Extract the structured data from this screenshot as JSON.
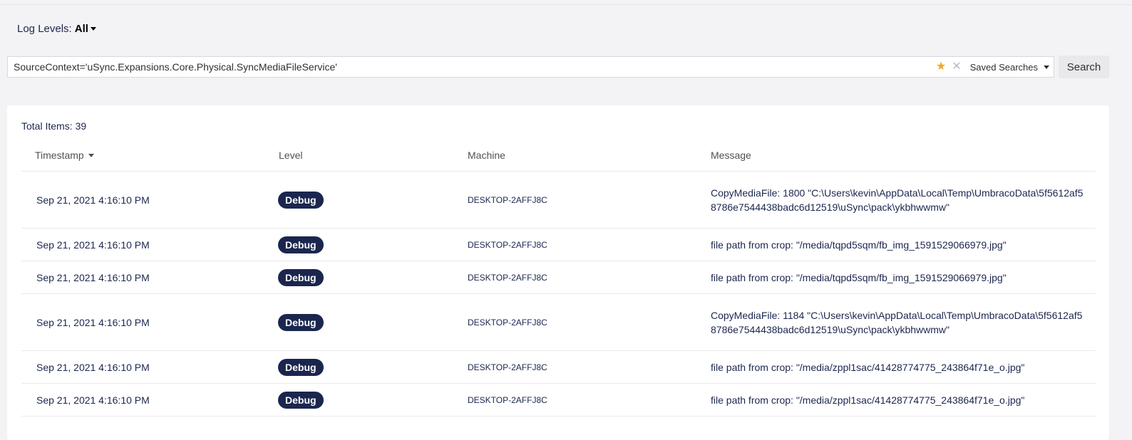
{
  "log_levels": {
    "label": "Log Levels:",
    "value": "All"
  },
  "search": {
    "query": "SourceContext='uSync.Expansions.Core.Physical.SyncMediaFileService'",
    "saved_searches_label": "Saved Searches",
    "button_label": "Search"
  },
  "results": {
    "total_label": "Total Items:",
    "total_count": "39",
    "columns": {
      "timestamp": "Timestamp",
      "level": "Level",
      "machine": "Machine",
      "message": "Message"
    },
    "rows": [
      {
        "timestamp": "Sep 21, 2021 4:16:10 PM",
        "level": "Debug",
        "machine": "DESKTOP-2AFFJ8C",
        "message": "CopyMediaFile: 1800 \"C:\\Users\\kevin\\AppData\\Local\\Temp\\UmbracoData\\5f5612af58786e7544438badc6d12519\\uSync\\pack\\ykbhwwmw\""
      },
      {
        "timestamp": "Sep 21, 2021 4:16:10 PM",
        "level": "Debug",
        "machine": "DESKTOP-2AFFJ8C",
        "message": "file path from crop: \"/media/tqpd5sqm/fb_img_1591529066979.jpg\""
      },
      {
        "timestamp": "Sep 21, 2021 4:16:10 PM",
        "level": "Debug",
        "machine": "DESKTOP-2AFFJ8C",
        "message": "file path from crop: \"/media/tqpd5sqm/fb_img_1591529066979.jpg\""
      },
      {
        "timestamp": "Sep 21, 2021 4:16:10 PM",
        "level": "Debug",
        "machine": "DESKTOP-2AFFJ8C",
        "message": "CopyMediaFile: 1184 \"C:\\Users\\kevin\\AppData\\Local\\Temp\\UmbracoData\\5f5612af58786e7544438badc6d12519\\uSync\\pack\\ykbhwwmw\""
      },
      {
        "timestamp": "Sep 21, 2021 4:16:10 PM",
        "level": "Debug",
        "machine": "DESKTOP-2AFFJ8C",
        "message": "file path from crop: \"/media/zppl1sac/41428774775_243864f71e_o.jpg\""
      },
      {
        "timestamp": "Sep 21, 2021 4:16:10 PM",
        "level": "Debug",
        "machine": "DESKTOP-2AFFJ8C",
        "message": "file path from crop: \"/media/zppl1sac/41428774775_243864f71e_o.jpg\""
      }
    ]
  },
  "colors": {
    "badge_bg": "#1b264f",
    "star": "#f5a623",
    "page_bg": "#f3f3f5"
  }
}
